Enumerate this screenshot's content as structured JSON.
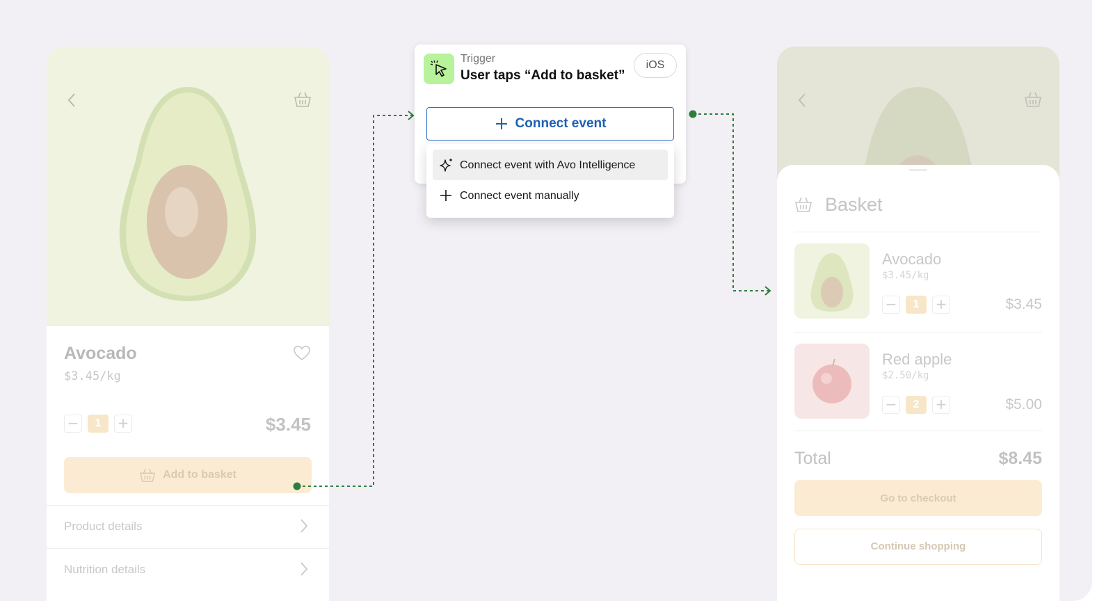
{
  "product": {
    "name": "Avocado",
    "unit_price": "$3.45/kg",
    "quantity": "1",
    "price": "$3.45",
    "add_to_basket_label": "Add to basket",
    "links": [
      {
        "label": "Product details"
      },
      {
        "label": "Nutrition details"
      }
    ]
  },
  "trigger": {
    "label": "Trigger",
    "title": "User taps “Add to basket”",
    "platform": "iOS",
    "connect_label": "Connect event",
    "menu": [
      {
        "label": "Connect event with Avo Intelligence",
        "icon": "sparkle-icon"
      },
      {
        "label": "Connect event manually",
        "icon": "plus-icon"
      }
    ]
  },
  "basket": {
    "title": "Basket",
    "items": [
      {
        "name": "Avocado",
        "unit_price": "$3.45/kg",
        "quantity": "1",
        "price": "$3.45"
      },
      {
        "name": "Red apple",
        "unit_price": "$2.50/kg",
        "quantity": "2",
        "price": "$5.00"
      }
    ],
    "total_label": "Total",
    "total_value": "$8.45",
    "checkout_label": "Go to checkout",
    "continue_label": "Continue shopping"
  },
  "colors": {
    "accent_blue": "#1e5fb4",
    "connector_green": "#2e7d3e",
    "trigger_icon_bg": "#b8f29a",
    "cta_bg": "#fbebd2"
  }
}
